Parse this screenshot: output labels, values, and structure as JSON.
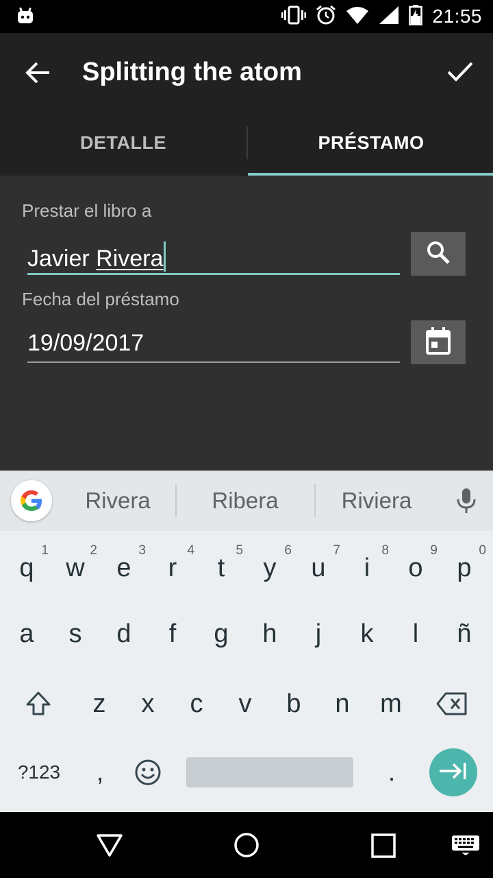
{
  "status_bar": {
    "time": "21:55",
    "icons": [
      "android-notification-icon",
      "vibrate-icon",
      "alarm-icon",
      "wifi-icon",
      "signal-icon",
      "battery-charging-icon"
    ]
  },
  "toolbar": {
    "title": "Splitting the atom",
    "back_icon": "arrow-back-icon",
    "confirm_icon": "check-icon"
  },
  "tabs": [
    {
      "label": "DETALLE",
      "selected": false
    },
    {
      "label": "PRÉSTAMO",
      "selected": true
    }
  ],
  "form": {
    "lend_to": {
      "label": "Prestar el libro a",
      "value_first": "Javier",
      "value_second": "Rivera",
      "button_icon": "search-icon"
    },
    "loan_date": {
      "label": "Fecha del préstamo",
      "value": "19/09/2017",
      "button_icon": "calendar-icon"
    }
  },
  "keyboard": {
    "suggestions": [
      "Rivera",
      "Ribera",
      "Riviera"
    ],
    "row1": [
      {
        "key": "q",
        "hint": "1"
      },
      {
        "key": "w",
        "hint": "2"
      },
      {
        "key": "e",
        "hint": "3"
      },
      {
        "key": "r",
        "hint": "4"
      },
      {
        "key": "t",
        "hint": "5"
      },
      {
        "key": "y",
        "hint": "6"
      },
      {
        "key": "u",
        "hint": "7"
      },
      {
        "key": "i",
        "hint": "8"
      },
      {
        "key": "o",
        "hint": "9"
      },
      {
        "key": "p",
        "hint": "0"
      }
    ],
    "row2": [
      "a",
      "s",
      "d",
      "f",
      "g",
      "h",
      "j",
      "k",
      "l",
      "ñ"
    ],
    "row3": [
      "z",
      "x",
      "c",
      "v",
      "b",
      "n",
      "m"
    ],
    "symbols_key": "?123",
    "comma_key": ",",
    "period_key": ".",
    "colors": {
      "accent": "#4db6ac",
      "background": "#eceff1"
    }
  },
  "colors": {
    "accent": "#80cbc4",
    "toolbar": "#212121",
    "background": "#303030"
  }
}
